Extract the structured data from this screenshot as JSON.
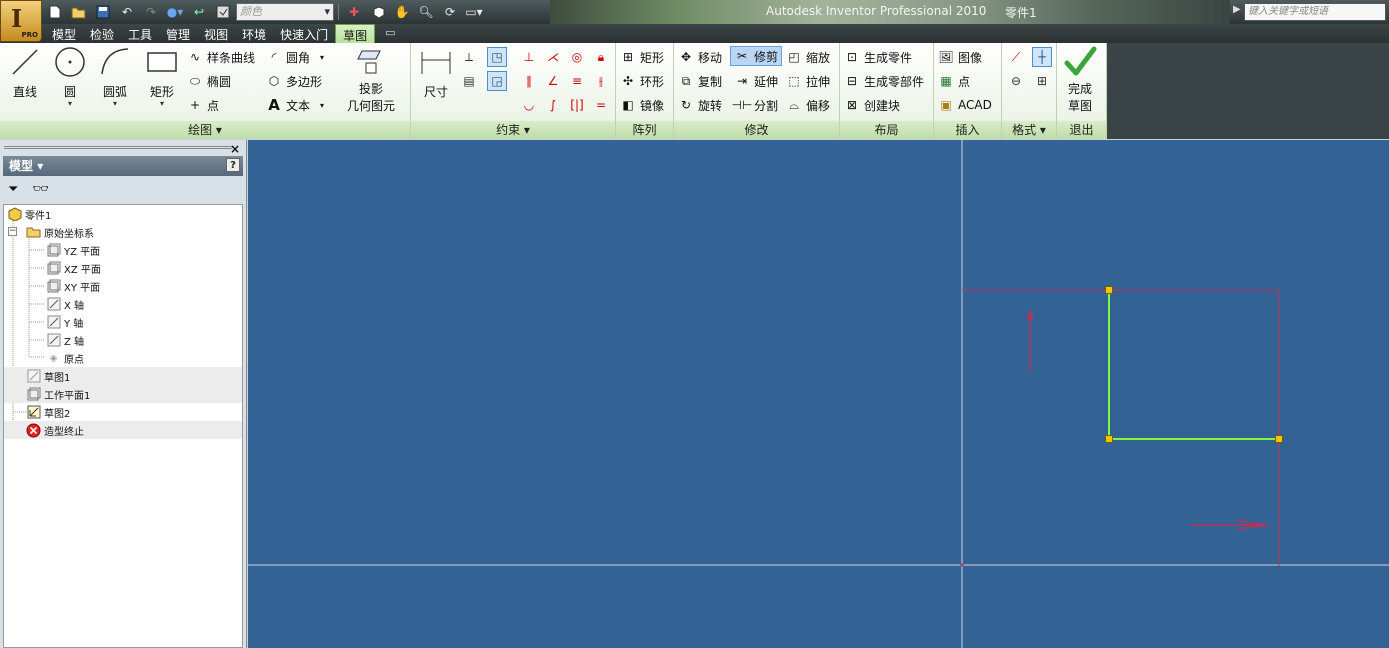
{
  "title_bar": {
    "app_title": "Autodesk Inventor Professional 2010",
    "document": "零件1",
    "color_select_value": "颜色",
    "help_search_placeholder": "键入关键字或短语",
    "app_button_badge": "PRO"
  },
  "tabs": [
    {
      "label": "模型"
    },
    {
      "label": "检验"
    },
    {
      "label": "工具"
    },
    {
      "label": "管理"
    },
    {
      "label": "视图"
    },
    {
      "label": "环境"
    },
    {
      "label": "快速入门"
    },
    {
      "label": "草图",
      "active": true
    }
  ],
  "ribbon": {
    "draw": {
      "title": "绘图",
      "line": "直线",
      "circle": "圆",
      "arc": "圆弧",
      "rectangle": "矩形",
      "spline": "样条曲线",
      "ellipse": "椭圆",
      "point": "点",
      "fillet": "圆角",
      "polygon": "多边形",
      "text": "文本"
    },
    "project": {
      "line1": "投影",
      "line2": "几何图元"
    },
    "constrain": {
      "title": "约束",
      "dimension": "尺寸"
    },
    "pattern": {
      "title": "阵列",
      "rect": "矩形",
      "circular": "环形",
      "mirror": "镜像"
    },
    "modify": {
      "title": "修改",
      "move": "移动",
      "trim": "修剪",
      "scale": "缩放",
      "copy": "复制",
      "extend": "延伸",
      "stretch": "拉伸",
      "rotate": "旋转",
      "split": "分割",
      "offset": "偏移"
    },
    "layout": {
      "title": "布局",
      "make_part": "生成零件",
      "make_components": "生成零部件",
      "create_block": "创建块"
    },
    "insert": {
      "title": "插入",
      "image": "图像",
      "point": "点",
      "acad": "ACAD"
    },
    "format": {
      "title": "格式"
    },
    "exit": {
      "title": "退出",
      "finish_line1": "完成",
      "finish_line2": "草图"
    }
  },
  "browser": {
    "header": "模型",
    "help": "?",
    "tree": [
      {
        "label": "零件1"
      },
      {
        "label": "原始坐标系"
      },
      {
        "label": "YZ 平面"
      },
      {
        "label": "XZ 平面"
      },
      {
        "label": "XY 平面"
      },
      {
        "label": "X 轴"
      },
      {
        "label": "Y 轴"
      },
      {
        "label": "Z 轴"
      },
      {
        "label": "原点"
      },
      {
        "label": "草图1"
      },
      {
        "label": "工作平面1"
      },
      {
        "label": "草图2"
      },
      {
        "label": "造型终止"
      }
    ]
  },
  "colors": {
    "canvas_bg": "#336395",
    "axis_line": "#c8d4e0",
    "projected_edge": "#b8335a",
    "sketch_line": "#7cfc3c",
    "endpoint": "#f5c400",
    "ribbon_active_tab": "#b7e19a"
  }
}
